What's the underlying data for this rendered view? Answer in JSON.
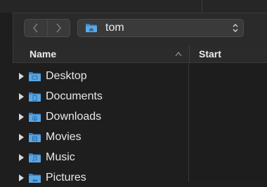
{
  "toolbar": {
    "back_icon": "chevron-left-icon",
    "forward_icon": "chevron-right-icon",
    "path_label": "tom",
    "path_icon": "home-folder-icon",
    "popup_icon": "updown-chevron-icon"
  },
  "columns": {
    "name": "Name",
    "start": "Start",
    "sort_icon": "sort-ascending-icon"
  },
  "items": [
    {
      "label": "Desktop",
      "icon": "desktop-folder-icon"
    },
    {
      "label": "Documents",
      "icon": "documents-folder-icon"
    },
    {
      "label": "Downloads",
      "icon": "downloads-folder-icon"
    },
    {
      "label": "Movies",
      "icon": "movies-folder-icon"
    },
    {
      "label": "Music",
      "icon": "music-folder-icon"
    },
    {
      "label": "Pictures",
      "icon": "pictures-folder-icon"
    }
  ],
  "colors": {
    "folder": "#5aa8e6",
    "folder_dark": "#3d86c6",
    "background": "#1e1e1e"
  }
}
